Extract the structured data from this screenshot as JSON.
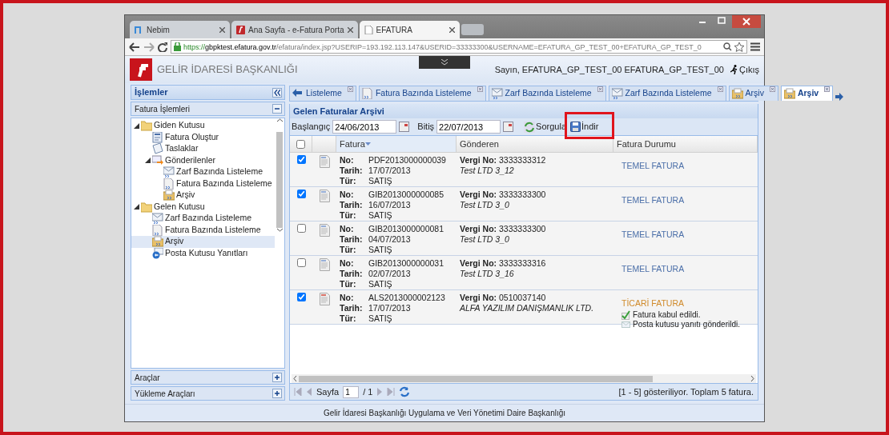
{
  "browser": {
    "tabs": [
      {
        "title": "Nebim",
        "kind": "n-logo",
        "selected": false
      },
      {
        "title": "Ana Sayfa - e-Fatura Porta",
        "kind": "red-logo",
        "selected": false
      },
      {
        "title": "EFATURA",
        "kind": "page",
        "selected": true
      }
    ],
    "address": {
      "scheme": "https://",
      "host": "gbpktest.efatura.gov.tr",
      "path": "/efatura/index.jsp?USERIP=193.192.113.147&USERID=33333300&USERNAME=EFATURA_GP_TEST_00+EFATURA_GP_TEST_0"
    }
  },
  "header": {
    "brand": "GELİR İDARESİ BAŞKANLIĞI",
    "user": "Sayın, EFATURA_GP_TEST_00 EFATURA_GP_TEST_00",
    "logout": "Çıkış"
  },
  "sidebar": {
    "title": "İşlemler",
    "sections": [
      {
        "title": "Fatura İşlemleri",
        "expanded": true,
        "tree": [
          {
            "label": "Giden Kutusu",
            "kind": "folder",
            "expanded": true,
            "selected": false,
            "children": [
              {
                "label": "Fatura Oluştur",
                "kind": "form",
                "selected": false
              },
              {
                "label": "Taslaklar",
                "kind": "note",
                "selected": false
              },
              {
                "label": "Gönderilenler",
                "kind": "sent",
                "expanded": true,
                "selected": false,
                "children": [
                  {
                    "label": "Zarf Bazında Listeleme",
                    "kind": "envelope",
                    "selected": false
                  },
                  {
                    "label": "Fatura Bazında Listeleme",
                    "kind": "document",
                    "selected": false
                  },
                  {
                    "label": "Arşiv",
                    "kind": "archive",
                    "selected": false
                  }
                ]
              }
            ]
          },
          {
            "label": "Gelen Kutusu",
            "kind": "folder",
            "expanded": true,
            "selected": false,
            "children": [
              {
                "label": "Zarf Bazında Listeleme",
                "kind": "envelope",
                "selected": false
              },
              {
                "label": "Fatura Bazında Listeleme",
                "kind": "document",
                "selected": false
              },
              {
                "label": "Arşiv",
                "kind": "archive",
                "selected": true
              },
              {
                "label": "Posta Kutusu Yanıtları",
                "kind": "reply",
                "selected": false
              }
            ]
          }
        ]
      },
      {
        "title": "Araçlar",
        "expanded": false
      },
      {
        "title": "Yükleme Araçları",
        "expanded": false
      }
    ]
  },
  "content_tabs": [
    {
      "label": "Listeleme",
      "kind": "arrow",
      "selected": false
    },
    {
      "label": "Fatura Bazında Listeleme",
      "kind": "document",
      "selected": false
    },
    {
      "label": "Zarf Bazında Listeleme",
      "kind": "envelope",
      "selected": false
    },
    {
      "label": "Zarf Bazında Listeleme",
      "kind": "envelope",
      "selected": false
    },
    {
      "label": "Arşiv",
      "kind": "archive",
      "selected": false
    },
    {
      "label": "Arşiv",
      "kind": "archive",
      "selected": true
    }
  ],
  "panel": {
    "title": "Gelen Faturalar Arşivi",
    "toolbar": {
      "start_label": "Başlangıç",
      "start_value": "24/06/2013",
      "end_label": "Bitiş",
      "end_value": "22/07/2013",
      "query": "Sorgula",
      "download": "İndir"
    },
    "table": {
      "all_checked": false,
      "columns": [
        {
          "label": "Fatura",
          "sorted": true
        },
        {
          "label": "Gönderen",
          "sorted": false
        },
        {
          "label": "Fatura Durumu",
          "sorted": false
        }
      ],
      "rows": [
        {
          "checked": true,
          "kind": "basic",
          "fields": [
            {
              "label": "No:",
              "value": "PDF2013000000039"
            },
            {
              "label": "Tarih:",
              "value": "17/07/2013"
            },
            {
              "label": "Tür:",
              "value": "SATIŞ"
            }
          ],
          "tax_label": "Vergi No:",
          "tax_no": "3333333312",
          "sender": "Test LTD 3_12",
          "status": "TEMEL FATURA",
          "notes": []
        },
        {
          "checked": true,
          "kind": "basic",
          "fields": [
            {
              "label": "No:",
              "value": "GIB2013000000085"
            },
            {
              "label": "Tarih:",
              "value": "16/07/2013"
            },
            {
              "label": "Tür:",
              "value": "SATIŞ"
            }
          ],
          "tax_label": "Vergi No:",
          "tax_no": "3333333300",
          "sender": "Test LTD 3_0",
          "status": "TEMEL FATURA",
          "notes": []
        },
        {
          "checked": false,
          "kind": "basic",
          "fields": [
            {
              "label": "No:",
              "value": "GIB2013000000081"
            },
            {
              "label": "Tarih:",
              "value": "04/07/2013"
            },
            {
              "label": "Tür:",
              "value": "SATIŞ"
            }
          ],
          "tax_label": "Vergi No:",
          "tax_no": "3333333300",
          "sender": "Test LTD 3_0",
          "status": "TEMEL FATURA",
          "notes": []
        },
        {
          "checked": false,
          "kind": "basic",
          "fields": [
            {
              "label": "No:",
              "value": "GIB2013000000031"
            },
            {
              "label": "Tarih:",
              "value": "02/07/2013"
            },
            {
              "label": "Tür:",
              "value": "SATIŞ"
            }
          ],
          "tax_label": "Vergi No:",
          "tax_no": "3333333316",
          "sender": "Test LTD 3_16",
          "status": "TEMEL FATURA",
          "notes": []
        },
        {
          "checked": true,
          "kind": "commercial",
          "fields": [
            {
              "label": "No:",
              "value": "ALS2013000002123"
            },
            {
              "label": "Tarih:",
              "value": "17/07/2013"
            },
            {
              "label": "Tür:",
              "value": "SATIŞ"
            }
          ],
          "tax_label": "Vergi No:",
          "tax_no": "0510037140",
          "sender": "ALFA YAZILIM DANIŞMANLIK LTD.",
          "status": "TİCARİ FATURA",
          "notes": [
            {
              "kind": "accepted",
              "text": "Fatura kabul edildi."
            },
            {
              "kind": "mail",
              "text": "Posta kutusu yanıtı gönderildi."
            }
          ]
        }
      ]
    },
    "pager": {
      "page_label": "Sayfa",
      "page": "1",
      "total": "/ 1",
      "summary": "[1 - 5] gösteriliyor. Toplam 5 fatura."
    }
  },
  "footer": "Gelir İdaresi Başkanlığı Uygulama ve Veri Yönetimi Daire Başkanlığı"
}
